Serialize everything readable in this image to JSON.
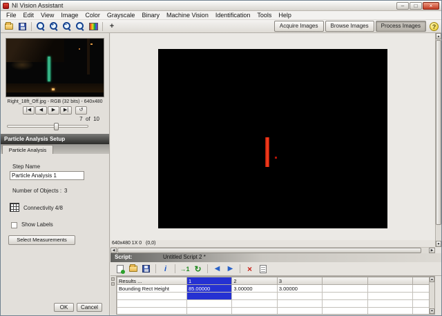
{
  "window": {
    "title": "NI Vision Assistant"
  },
  "menu": {
    "items": [
      "File",
      "Edit",
      "View",
      "Image",
      "Color",
      "Grayscale",
      "Binary",
      "Machine Vision",
      "Identification",
      "Tools",
      "Help"
    ]
  },
  "toolbar": {
    "modes": [
      {
        "label": "Acquire Images"
      },
      {
        "label": "Browse Images"
      },
      {
        "label": "Process Images"
      }
    ],
    "active_mode": "Process Images"
  },
  "browser": {
    "caption": "Right_18ft_Off.jpg - RGB (32 bits) - 640x480",
    "position": "7  of  10"
  },
  "setup": {
    "title": "Particle Analysis Setup",
    "tab": "Particle Analysis",
    "step_name_label": "Step Name",
    "step_name": "Particle Analysis 1",
    "objects_label": "Number of Objects :",
    "objects_value": "3",
    "connectivity_label": "Connectivity 4/8",
    "show_labels_label": "Show Labels",
    "select_measurements_label": "Select Measurements",
    "ok_label": "OK",
    "cancel_label": "Cancel"
  },
  "viewer": {
    "status": "640x480 1X 0   (0,0)"
  },
  "script": {
    "label": "Script:",
    "name": "Untitled Script 2 *"
  },
  "results": {
    "header": [
      "Results ...",
      "1",
      "2",
      "3"
    ],
    "rows": [
      {
        "label": "Bounding Rect Height",
        "values": [
          "85.00000",
          "3.00000",
          "3.00000"
        ]
      }
    ],
    "selected_column": "1",
    "selection_color": "#2531d2"
  },
  "icons": {
    "minimize": "–",
    "maximize": "□",
    "close": "×",
    "nav_first": "|◀",
    "nav_prev": "◀",
    "nav_next": "▶",
    "nav_last": "▶|",
    "nav_loop": "↺",
    "zoom_in": "+",
    "zoom_out": "−",
    "cross": "+",
    "help": "?",
    "info": "i",
    "run_once": "→1",
    "run_loop": "↻",
    "back": "◀",
    "forward": "▶",
    "delete": "×",
    "up": "▲",
    "down": "▼",
    "left": "◀",
    "right": "▶"
  }
}
